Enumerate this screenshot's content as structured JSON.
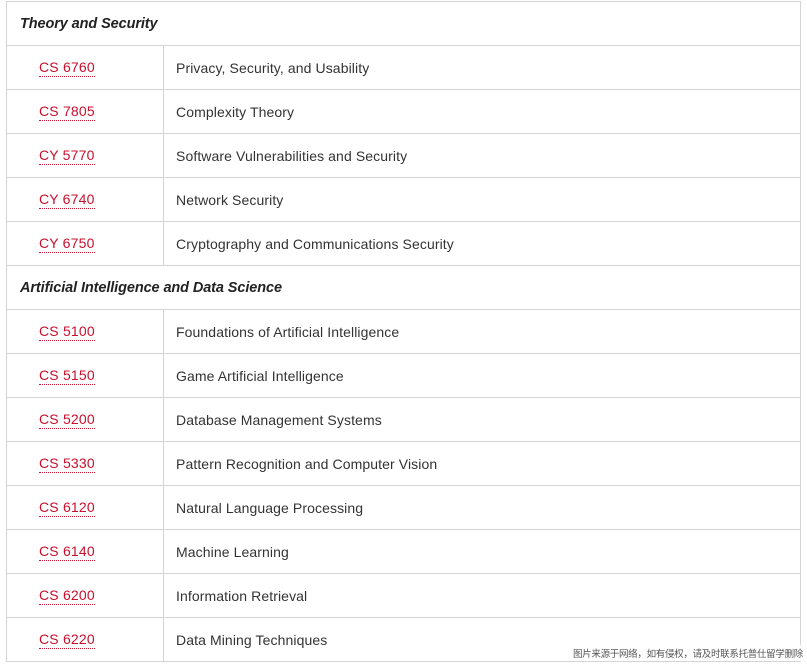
{
  "sections": [
    {
      "title": "Theory and Security",
      "courses": [
        {
          "code": "CS 6760",
          "name": "Privacy, Security, and Usability"
        },
        {
          "code": "CS 7805",
          "name": "Complexity Theory"
        },
        {
          "code": "CY 5770",
          "name": "Software Vulnerabilities and Security"
        },
        {
          "code": "CY 6740",
          "name": "Network Security"
        },
        {
          "code": "CY 6750",
          "name": "Cryptography and Communications Security"
        }
      ]
    },
    {
      "title": "Artificial Intelligence and Data Science",
      "courses": [
        {
          "code": "CS 5100",
          "name": "Foundations of Artificial Intelligence"
        },
        {
          "code": "CS 5150",
          "name": "Game Artificial Intelligence"
        },
        {
          "code": "CS 5200",
          "name": "Database Management Systems"
        },
        {
          "code": "CS 5330",
          "name": "Pattern Recognition and Computer Vision"
        },
        {
          "code": "CS 6120",
          "name": "Natural Language Processing"
        },
        {
          "code": "CS 6140",
          "name": "Machine Learning"
        },
        {
          "code": "CS 6200",
          "name": "Information Retrieval"
        },
        {
          "code": "CS 6220",
          "name": "Data Mining Techniques"
        }
      ]
    }
  ],
  "watermark": "图片来源于网络，如有侵权，请及时联系托普仕留学删除",
  "colors": {
    "link": "#c8102e",
    "border": "#d4d4d4",
    "text": "#333333"
  }
}
